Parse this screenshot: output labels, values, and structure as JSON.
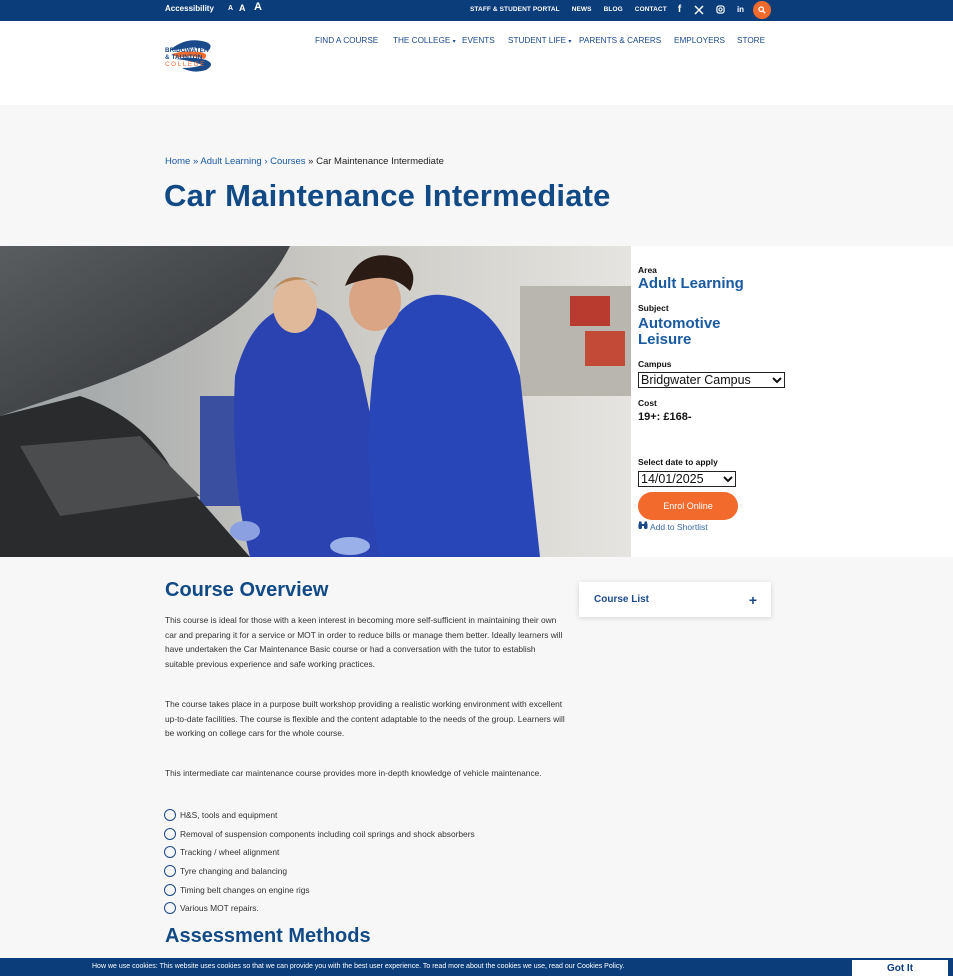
{
  "topbar": {
    "accessibility_label": "Accessibility",
    "text_size": [
      "A",
      "A",
      "A"
    ],
    "links": [
      "STAFF & STUDENT PORTAL",
      "NEWS",
      "BLOG",
      "CONTACT"
    ],
    "social_icons": [
      "facebook-icon",
      "x-icon",
      "instagram-icon",
      "linkedin-icon"
    ]
  },
  "logo": {
    "line1": "BRIDGWATER",
    "line2": "& TAUNTON",
    "line3": "COLLEGE"
  },
  "nav": {
    "items": [
      "FIND A COURSE",
      "THE COLLEGE",
      "EVENTS",
      "STUDENT LIFE",
      "PARENTS & CARERS",
      "EMPLOYERS",
      "STORE"
    ]
  },
  "breadcrumb": {
    "home": "Home",
    "sep1": "»",
    "adult": "Adult Learning",
    "sep2": "›",
    "courses": "Courses",
    "sep3": "»",
    "current": "Car Maintenance Intermediate"
  },
  "page_title": "Car Maintenance Intermediate",
  "info": {
    "area_label": "Area",
    "area_value": "Adult Learning",
    "subject_label": "Subject",
    "subject_line1": "Automotive",
    "subject_line2": "Leisure",
    "campus_label": "Campus",
    "campus_value": "Bridgwater Campus",
    "cost_label": "Cost",
    "cost_value": "19+: £168-",
    "date_label": "Select date to apply",
    "date_value": "14/01/2025",
    "enrol_label": "Enrol Online",
    "shortlist_label": "Add to Shortlist"
  },
  "overview": {
    "heading": "Course Overview",
    "p1": "This course is ideal for those with a keen interest in becoming more self-sufficient in maintaining their own car and preparing it for a service or MOT in order to reduce bills or manage them better. Ideally learners will have undertaken the Car Maintenance Basic course or had a conversation with the tutor to establish suitable previous experience and safe working practices.",
    "p2": "The course takes place in a purpose built workshop providing a realistic working environment with excellent up-to-date facilities. The course is flexible and the content adaptable to the needs of the group. Learners will be working on college cars for the whole course.",
    "p3": "This intermediate car maintenance course provides more in-depth knowledge of vehicle maintenance.",
    "bullets": [
      "H&S, tools and equipment",
      "Removal of suspension components including coil springs and shock absorbers",
      "Tracking / wheel alignment",
      "Tyre changing and balancing",
      "Timing belt changes on engine rigs",
      "Various MOT repairs."
    ]
  },
  "assessment": {
    "heading": "Assessment Methods"
  },
  "sidebar": {
    "course_list_label": "Course List",
    "plus": "+"
  },
  "cookie": {
    "text": "How we use cookies: This website uses cookies so that we can provide you with the best user experience. To read more about the cookies we use, read our Cookies Policy.",
    "button": "Got It"
  },
  "colors": {
    "navy": "#0b3d7a",
    "title_blue": "#124a86",
    "link_blue": "#1a5aa0",
    "orange": "#f26a2c"
  }
}
